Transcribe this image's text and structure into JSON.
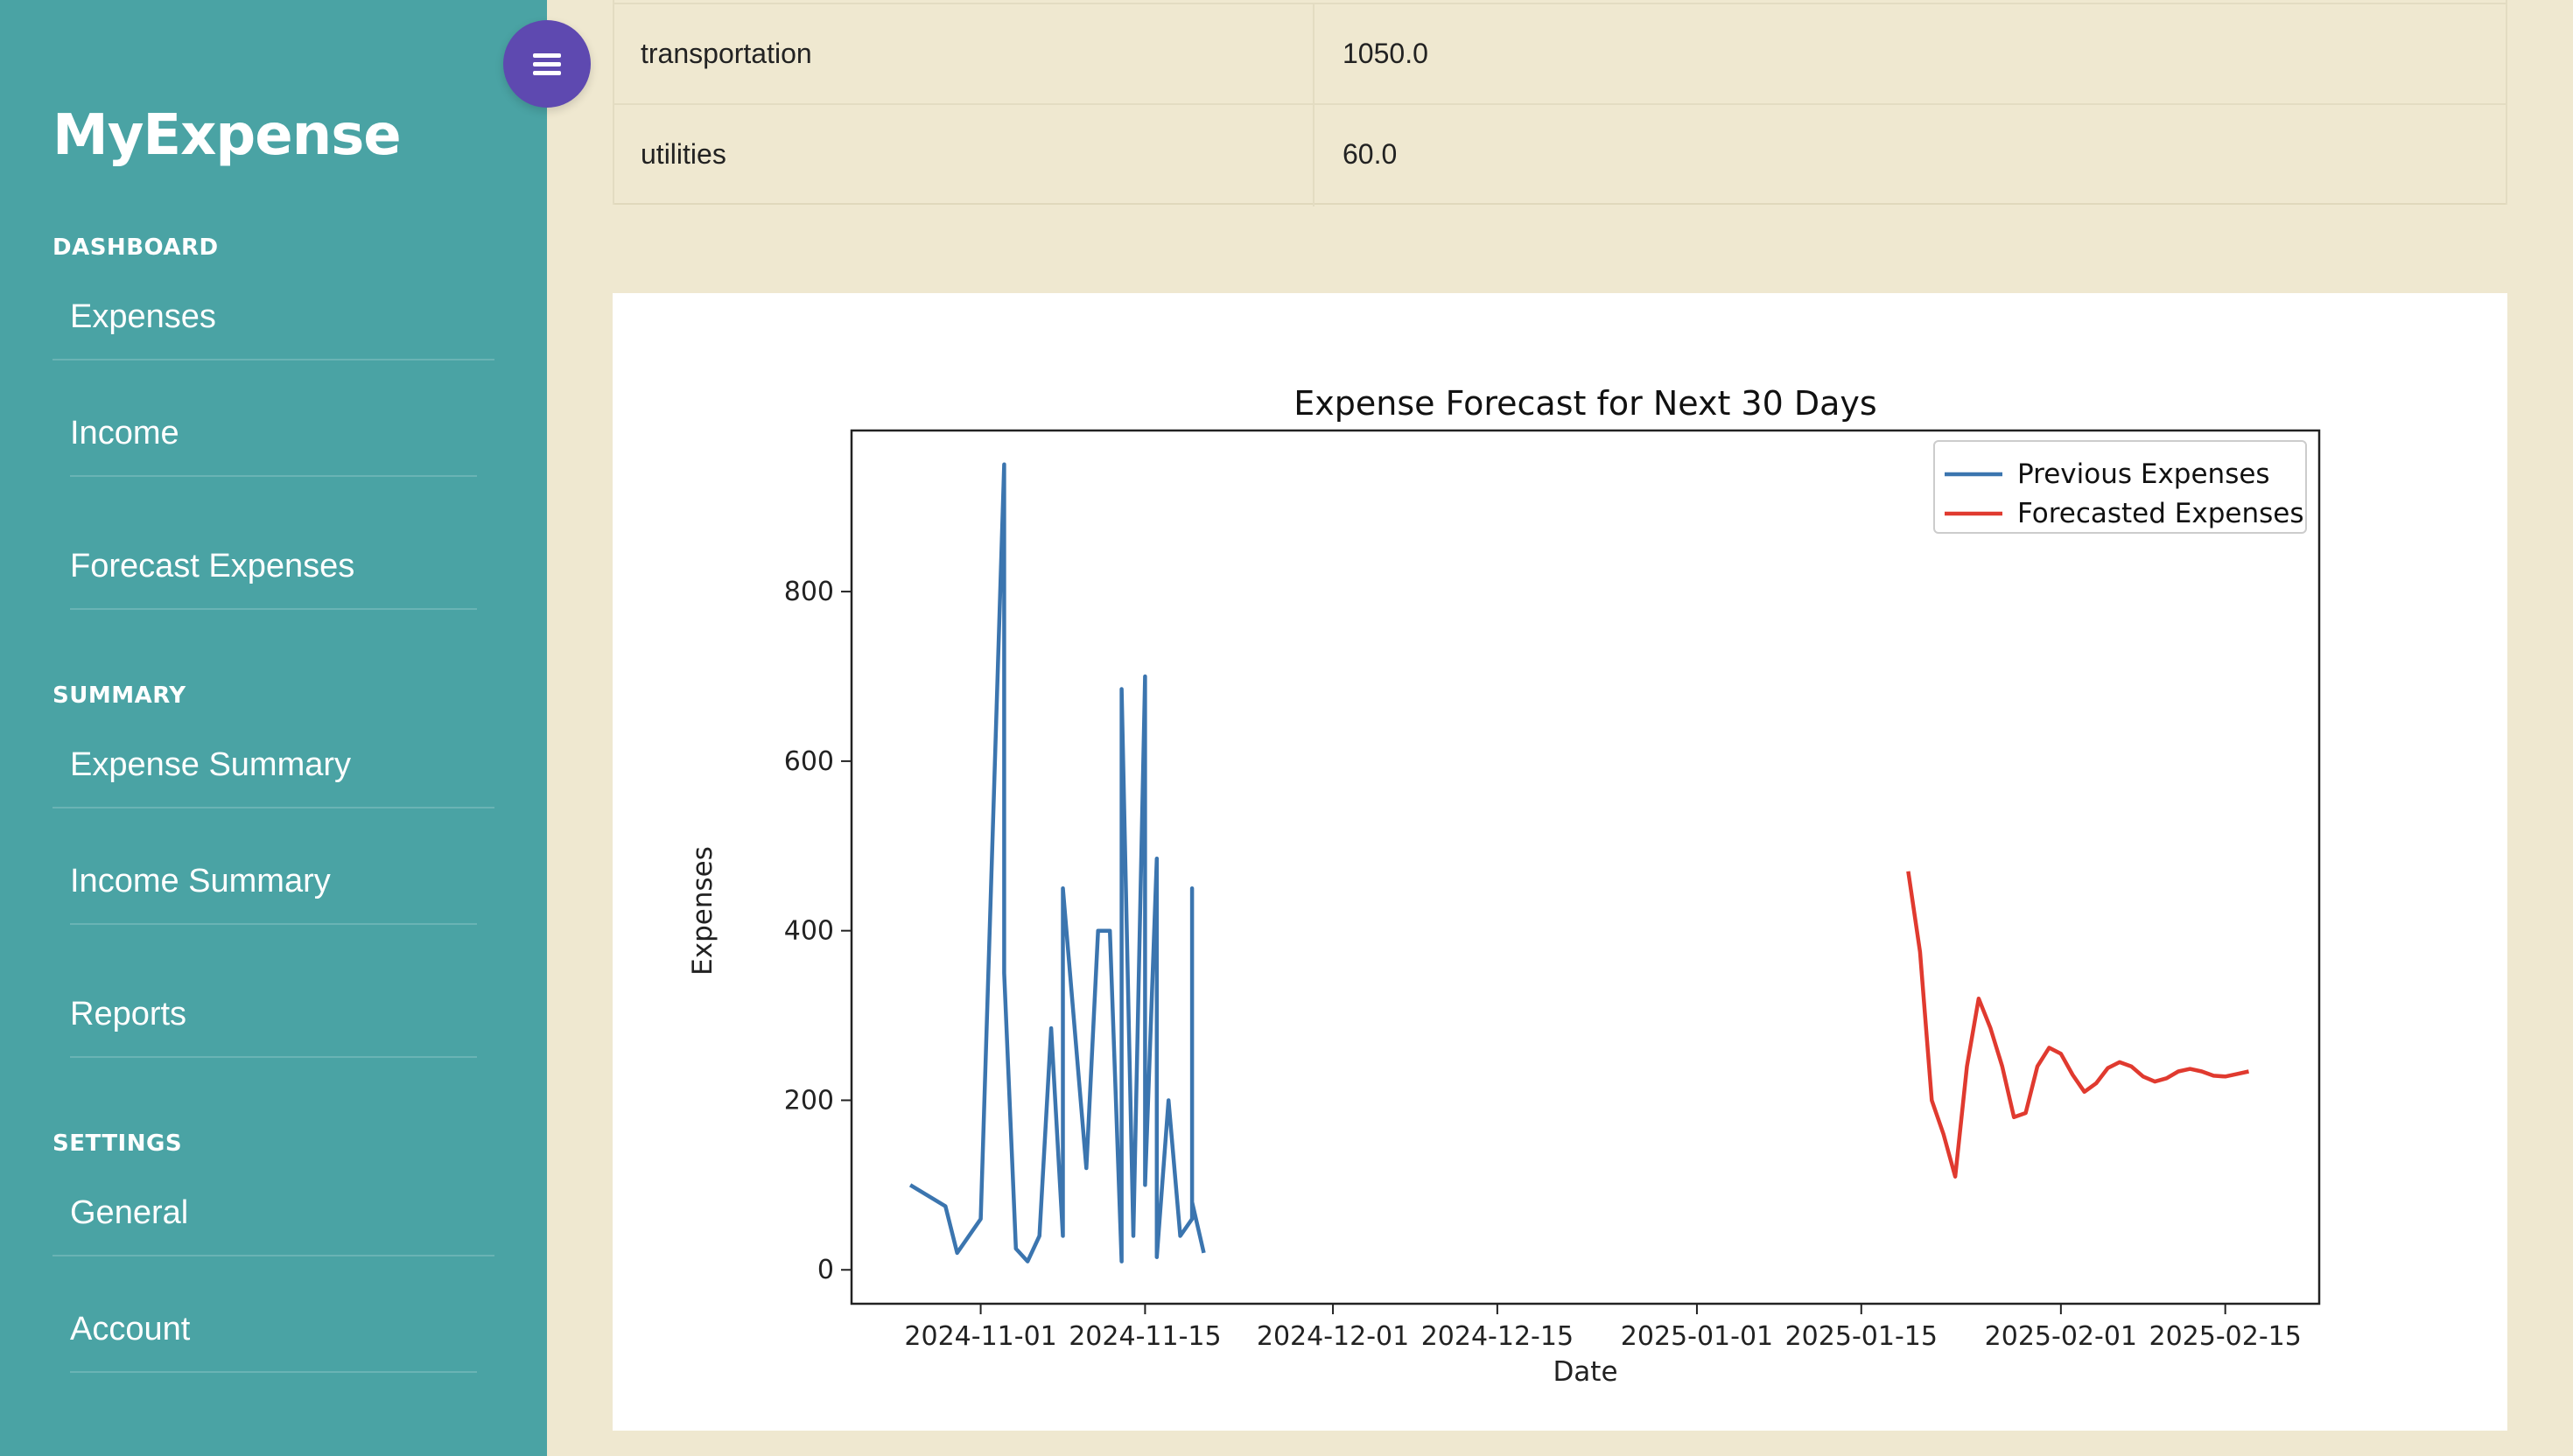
{
  "sidebar": {
    "brand": "MyExpense",
    "sections": [
      {
        "title": "DASHBOARD",
        "items": [
          "Expenses",
          "Income",
          "Forecast Expenses"
        ]
      },
      {
        "title": "SUMMARY",
        "items": [
          "Expense Summary",
          "Income Summary",
          "Reports"
        ]
      },
      {
        "title": "SETTINGS",
        "items": [
          "General",
          "Account"
        ]
      }
    ],
    "menu_icon": "hamburger-icon",
    "colors": {
      "sidebar_bg": "#4aa3a4",
      "toggle_bg": "#5e49b0",
      "page_bg": "#efe8d0"
    }
  },
  "table": {
    "rows": [
      {
        "category": "transportation",
        "amount": "1050.0"
      },
      {
        "category": "utilities",
        "amount": "60.0"
      }
    ]
  },
  "chart_data": {
    "type": "line",
    "title": "Expense Forecast for Next 30 Days",
    "xlabel": "Date",
    "ylabel": "Expenses",
    "x_ticks": [
      "2024-11-01",
      "2024-11-15",
      "2024-12-01",
      "2024-12-15",
      "2025-01-01",
      "2025-01-15",
      "2025-02-01",
      "2025-02-15"
    ],
    "y_ticks": [
      0,
      200,
      400,
      600,
      800
    ],
    "ylim": [
      -40,
      990
    ],
    "xlim": [
      "2024-10-21",
      "2025-02-23"
    ],
    "legend": "top-right",
    "grid": false,
    "series": [
      {
        "name": "Previous Expenses",
        "color": "#3b75af",
        "points": [
          [
            "2024-10-26",
            100
          ],
          [
            "2024-10-29",
            75
          ],
          [
            "2024-10-30",
            20
          ],
          [
            "2024-11-01",
            60
          ],
          [
            "2024-11-03",
            950
          ],
          [
            "2024-11-03",
            350
          ],
          [
            "2024-11-04",
            25
          ],
          [
            "2024-11-05",
            10
          ],
          [
            "2024-11-06",
            40
          ],
          [
            "2024-11-07",
            285
          ],
          [
            "2024-11-08",
            40
          ],
          [
            "2024-11-08",
            450
          ],
          [
            "2024-11-10",
            120
          ],
          [
            "2024-11-11",
            400
          ],
          [
            "2024-11-12",
            400
          ],
          [
            "2024-11-13",
            10
          ],
          [
            "2024-11-13",
            685
          ],
          [
            "2024-11-14",
            40
          ],
          [
            "2024-11-15",
            700
          ],
          [
            "2024-11-15",
            100
          ],
          [
            "2024-11-16",
            485
          ],
          [
            "2024-11-16",
            15
          ],
          [
            "2024-11-17",
            200
          ],
          [
            "2024-11-18",
            40
          ],
          [
            "2024-11-19",
            60
          ],
          [
            "2024-11-19",
            450
          ],
          [
            "2024-11-19",
            80
          ],
          [
            "2024-11-20",
            20
          ]
        ]
      },
      {
        "name": "Forecasted Expenses",
        "color": "#e03a2f",
        "points": [
          [
            "2025-01-19",
            470
          ],
          [
            "2025-01-20",
            375
          ],
          [
            "2025-01-21",
            200
          ],
          [
            "2025-01-22",
            160
          ],
          [
            "2025-01-23",
            110
          ],
          [
            "2025-01-24",
            240
          ],
          [
            "2025-01-25",
            320
          ],
          [
            "2025-01-26",
            285
          ],
          [
            "2025-01-27",
            240
          ],
          [
            "2025-01-28",
            180
          ],
          [
            "2025-01-29",
            185
          ],
          [
            "2025-01-30",
            240
          ],
          [
            "2025-01-31",
            262
          ],
          [
            "2025-02-01",
            255
          ],
          [
            "2025-02-02",
            230
          ],
          [
            "2025-02-03",
            210
          ],
          [
            "2025-02-04",
            220
          ],
          [
            "2025-02-05",
            238
          ],
          [
            "2025-02-06",
            245
          ],
          [
            "2025-02-07",
            240
          ],
          [
            "2025-02-08",
            228
          ],
          [
            "2025-02-09",
            222
          ],
          [
            "2025-02-10",
            226
          ],
          [
            "2025-02-11",
            234
          ],
          [
            "2025-02-12",
            237
          ],
          [
            "2025-02-13",
            234
          ],
          [
            "2025-02-14",
            229
          ],
          [
            "2025-02-15",
            228
          ],
          [
            "2025-02-16",
            231
          ],
          [
            "2025-02-17",
            234
          ]
        ]
      }
    ]
  }
}
